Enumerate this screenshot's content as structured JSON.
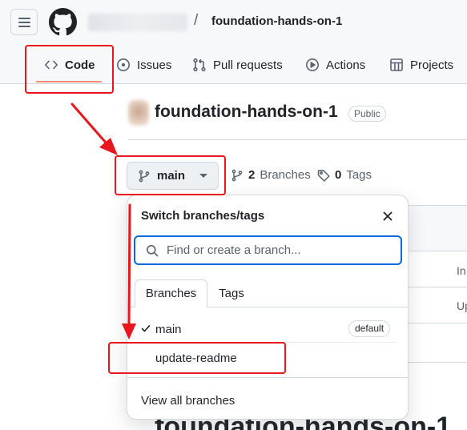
{
  "header": {
    "repo_name": "foundation-hands-on-1",
    "separator": "/",
    "tabs": [
      {
        "label": "Code",
        "icon": "code-icon",
        "selected": true
      },
      {
        "label": "Issues",
        "icon": "issue-opened-icon"
      },
      {
        "label": "Pull requests",
        "icon": "git-pull-request-icon"
      },
      {
        "label": "Actions",
        "icon": "play-icon"
      },
      {
        "label": "Projects",
        "icon": "table-icon"
      }
    ]
  },
  "repo": {
    "title": "foundation-hands-on-1",
    "visibility": "Public",
    "branch_button_label": "main",
    "branches_count": "2",
    "branches_label": "Branches",
    "tags_count": "0",
    "tags_label": "Tags",
    "readme_heading": "foundation-hands-on-1"
  },
  "background_table": {
    "cell_1": "In",
    "cell_2": "Up"
  },
  "popup": {
    "title": "Switch branches/tags",
    "search_placeholder": "Find or create a branch...",
    "tabs": [
      "Branches",
      "Tags"
    ],
    "branches": [
      {
        "name": "main",
        "checked": true,
        "badge": "default"
      },
      {
        "name": "update-readme",
        "checked": false
      }
    ],
    "view_all": "View all branches"
  },
  "colors": {
    "annotation_red": "#e8171d",
    "focus_blue": "#0969da",
    "tab_underline": "#fd8c73"
  }
}
